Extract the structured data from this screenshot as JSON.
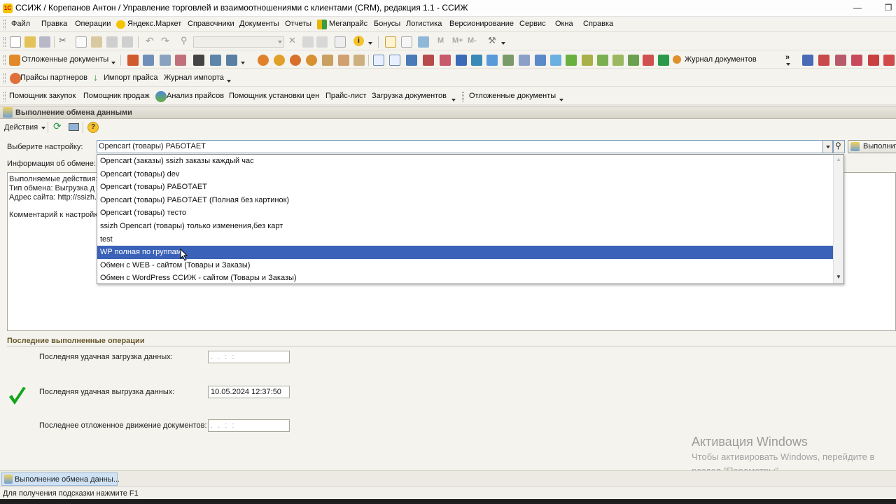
{
  "window": {
    "title": "ССИЖ / Корепанов Антон / Управление торговлей и взаимоотношениями с клиентами (CRM), редакция 1.1 - ССИЖ",
    "logo": "1С"
  },
  "menu": [
    "Файл",
    "Правка",
    "Операции",
    "Яндекс.Маркет",
    "Справочники",
    "Документы",
    "Отчеты",
    "Мегапрайс",
    "Бонусы",
    "Логистика",
    "Версионирование",
    "Сервис",
    "Окна",
    "Справка"
  ],
  "toolbar2": {
    "deferred_docs": "Отложенные документы",
    "journal_docs": "Журнал документов"
  },
  "toolbar3": {
    "partner_prices": "Прайсы партнеров",
    "import_price": "Импорт прайса",
    "import_journal": "Журнал импорта"
  },
  "toolbar4": [
    "Помощник закупок",
    "Помощник продаж",
    "Анализ прайсов",
    "Помощник установки цен",
    "Прайс-лист",
    "Загрузка документов",
    "Отложенные документы"
  ],
  "panel": {
    "title": "Выполнение обмена данными",
    "actions": "Действия",
    "choose_setting_label": "Выберите настройку:",
    "selected_setting": "Opencart (товары) РАБОТАЕТ",
    "exec_button": "Выполнить",
    "exchange_info_label": "Информация об обмене:",
    "info_lines": [
      "Выполняемые действия:",
      "Тип обмена:  Выгрузка д",
      "Адрес сайта: http://ssizh.r",
      "Комментарий к настройк"
    ]
  },
  "dropdown": {
    "options": [
      "Opencart (заказы) ssizh заказы каждый час",
      "Opencart (товары) dev",
      "Opencart (товары) РАБОТАЕТ",
      "Opencart (товары) РАБОТАЕТ (Полная без картинок)",
      "Opencart (товары) тесто",
      "ssizh Opencart (товары) только изменения,без карт",
      "test",
      "WP полная по группам",
      "Обмен с WEB - сайтом (Товары и Заказы)",
      "Обмен с WordPress ССИЖ  - сайтом (Товары и Заказы)"
    ],
    "selected_index": 7
  },
  "last_ops": {
    "title": "Последние выполненные операции",
    "rows": [
      {
        "label": "Последняя удачная загрузка данных:",
        "value": " .  .     :  :",
        "empty": true
      },
      {
        "label": "Последняя удачная выгрузка данных:",
        "value": "10.05.2024 12:37:50",
        "empty": false
      },
      {
        "label": "Последнее отложенное движение документов:",
        "value": " .  .     :  :",
        "empty": true
      }
    ]
  },
  "watermark": {
    "line1": "Активация Windows",
    "line2": "Чтобы активировать Windows, перейдите в",
    "line3": "раздел \"Параметры\"."
  },
  "taskbar": {
    "tab": "Выполнение обмена данны..."
  },
  "status": {
    "hint": "Для получения подсказки нажмите F1"
  },
  "colors": {
    "selection": "#3b62b9",
    "check": "#12a51b",
    "section_title": "#6b5a2e"
  }
}
